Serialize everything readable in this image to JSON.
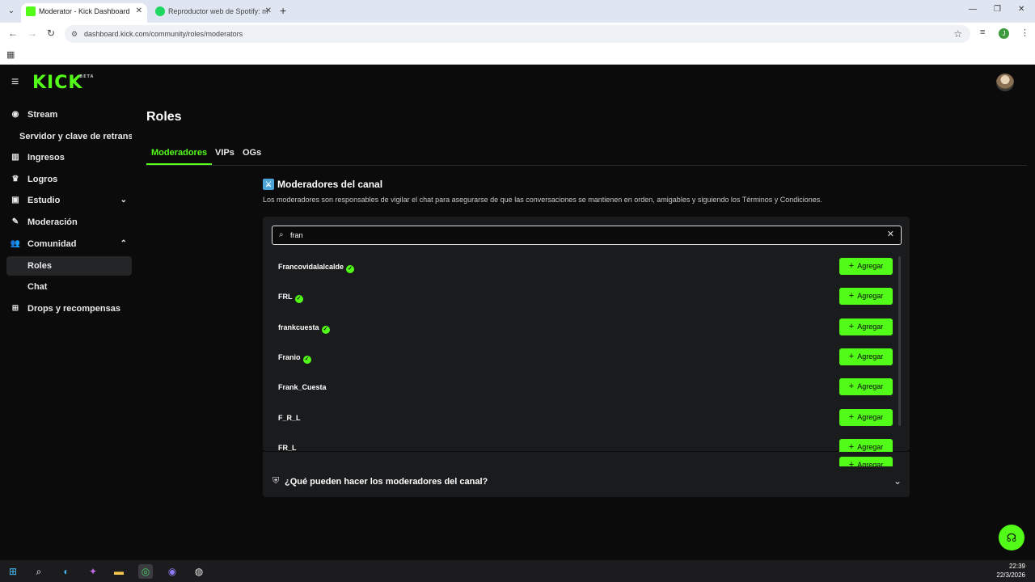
{
  "browser": {
    "tabs": [
      {
        "title": "Moderator - Kick Dashboard",
        "active": true
      },
      {
        "title": "Reproductor web de Spotify: m",
        "active": false
      }
    ],
    "url": "dashboard.kick.com/community/roles/moderators",
    "profile_initial": "J"
  },
  "app": {
    "logo": "KICK",
    "logo_badge": "BETA",
    "sidebar": [
      {
        "label": "Stream",
        "icon": "broadcast-icon"
      },
      {
        "label": "Servidor y clave de retransmisión",
        "icon": ""
      },
      {
        "label": "Ingresos",
        "icon": "chart-icon"
      },
      {
        "label": "Logros",
        "icon": "trophy-icon"
      },
      {
        "label": "Estudio",
        "icon": "studio-icon",
        "expandable": true
      },
      {
        "label": "Moderación",
        "icon": "wrench-icon"
      },
      {
        "label": "Comunidad",
        "icon": "users-icon",
        "expanded": true
      },
      {
        "label": "Roles",
        "icon": "",
        "selected": true
      },
      {
        "label": "Chat",
        "icon": ""
      },
      {
        "label": "Drops y recompensas",
        "icon": "gift-icon"
      }
    ],
    "page_title": "Roles",
    "role_tabs": [
      {
        "label": "Moderadores",
        "active": true
      },
      {
        "label": "VIPs",
        "active": false
      },
      {
        "label": "OGs",
        "active": false
      }
    ],
    "section": {
      "title": "Moderadores del canal",
      "description": "Los moderadores son responsables de vigilar el chat para asegurarse de que las conversaciones se mantienen en orden, amigables y siguiendo los Términos y Condiciones."
    },
    "search": {
      "value": "fran",
      "placeholder": ""
    },
    "add_label": "Agregar",
    "results": [
      {
        "name": "Francovidalalcalde",
        "verified": true
      },
      {
        "name": "FRL",
        "verified": true
      },
      {
        "name": "frankcuesta",
        "verified": true
      },
      {
        "name": "Franio",
        "verified": true
      },
      {
        "name": "Frank_Cuesta",
        "verified": false
      },
      {
        "name": "F_R_L",
        "verified": false
      },
      {
        "name": "FR_L",
        "verified": false
      }
    ],
    "faq_question": "¿Qué pueden hacer los moderadores del canal?"
  },
  "taskbar": {
    "time": "22:39",
    "date": "22/3/2026"
  },
  "colors": {
    "accent": "#53fc18",
    "background": "#0b0b0c",
    "panel": "#1a1b1d"
  }
}
